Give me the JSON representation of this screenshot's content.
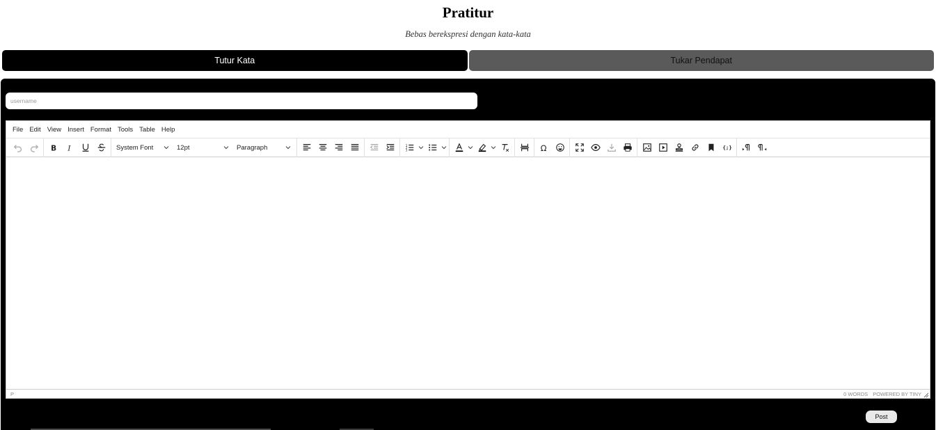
{
  "header": {
    "title": "Pratitur",
    "tagline": "Bebas berekspresi dengan kata-kata"
  },
  "tabs": [
    {
      "label": "Tutur Kata",
      "active": true
    },
    {
      "label": "Tukar Pendapat",
      "active": false
    }
  ],
  "form": {
    "username_placeholder": "username",
    "username_value": "",
    "post_label": "Post"
  },
  "editor": {
    "menu": [
      "File",
      "Edit",
      "View",
      "Insert",
      "Format",
      "Tools",
      "Table",
      "Help"
    ],
    "font_family": "System Font",
    "font_size": "12pt",
    "block_format": "Paragraph",
    "status_path": "P",
    "word_count": "0 WORDS",
    "powered_by": "POWERED BY TINY"
  },
  "colors": {
    "panel_bg": "#000000",
    "tab_active": "#000000",
    "tab_inactive": "#5a5a5a"
  }
}
